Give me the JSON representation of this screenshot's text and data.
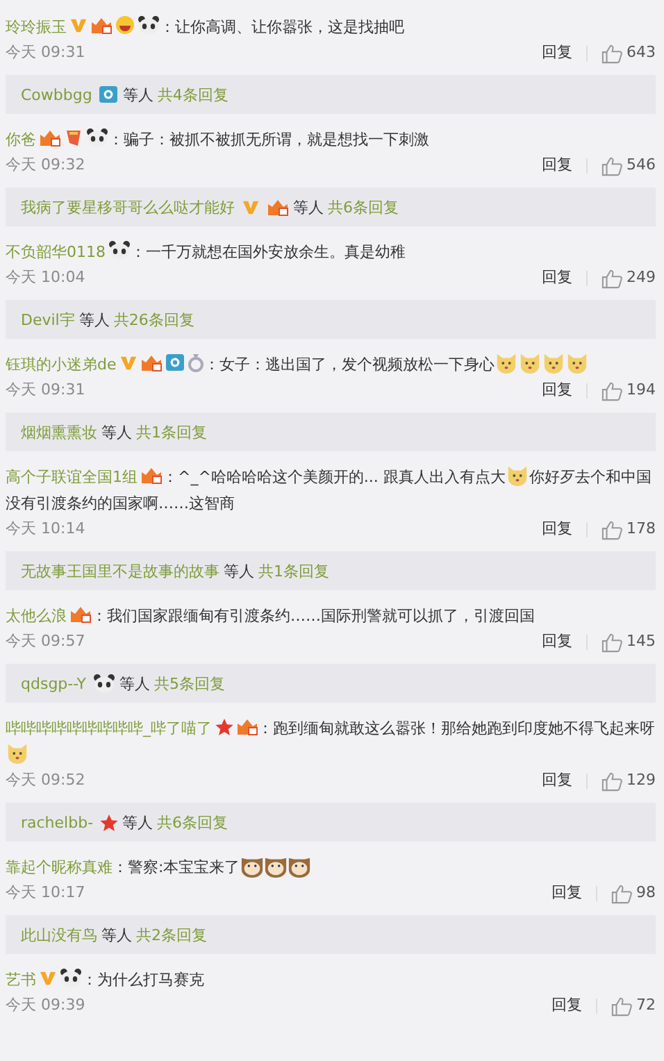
{
  "comments": [
    {
      "user": "玲玲振玉",
      "badges": [
        {
          "kind": "v"
        },
        {
          "kind": "vip"
        },
        {
          "kind": "grin"
        },
        {
          "kind": "panda"
        }
      ],
      "parts": [
        {
          "kind": "text",
          "text": "：让你高调、让你嚣张，这是找抽吧"
        }
      ],
      "time": "今天 09:31",
      "reply": "回复",
      "likes": "643",
      "thread": {
        "names": "Cowbbgg",
        "badges": [
          {
            "kind": "camera"
          }
        ],
        "others": "等人",
        "count": "共4条回复"
      }
    },
    {
      "user": "你爸",
      "badges": [
        {
          "kind": "vip"
        },
        {
          "kind": "medal"
        },
        {
          "kind": "panda"
        }
      ],
      "parts": [
        {
          "kind": "text",
          "text": "：骗子：被抓不被抓无所谓，就是想找一下刺激"
        }
      ],
      "time": "今天 09:32",
      "reply": "回复",
      "likes": "546",
      "thread": {
        "names": "我病了要星移哥哥么么哒才能好",
        "badges": [
          {
            "kind": "v"
          },
          {
            "kind": "vip"
          }
        ],
        "others": "等人",
        "count": "共6条回复"
      }
    },
    {
      "user": "不负韶华0118",
      "badges": [
        {
          "kind": "panda"
        }
      ],
      "parts": [
        {
          "kind": "text",
          "text": "：一千万就想在国外安放余生。真是幼稚"
        }
      ],
      "time": "今天 10:04",
      "reply": "回复",
      "likes": "249",
      "thread": {
        "names": "Devil宇",
        "others": "等人",
        "count": "共26条回复"
      }
    },
    {
      "user": "钰琪的小迷弟de",
      "badges": [
        {
          "kind": "v"
        },
        {
          "kind": "vip"
        },
        {
          "kind": "camera"
        },
        {
          "kind": "ring"
        }
      ],
      "parts": [
        {
          "kind": "text",
          "text": "：女子：逃出国了，发个视频放松一下身心"
        },
        {
          "kind": "cat"
        },
        {
          "kind": "cat"
        },
        {
          "kind": "cat"
        },
        {
          "kind": "cat"
        }
      ],
      "time": "今天 09:31",
      "reply": "回复",
      "likes": "194",
      "thread": {
        "names": "烟烟熏熏妆",
        "others": "等人",
        "count": "共1条回复"
      }
    },
    {
      "user": "高个子联谊全国1组",
      "badges": [
        {
          "kind": "vip"
        }
      ],
      "parts": [
        {
          "kind": "text",
          "text": "：^_^哈哈哈哈这个美颜开的... 跟真人出入有点大"
        },
        {
          "kind": "cat"
        },
        {
          "kind": "text",
          "text": "你好歹去个和中国没有引渡条约的国家啊……这智商"
        }
      ],
      "time": "今天 10:14",
      "reply": "回复",
      "likes": "178",
      "thread": {
        "names": "无故事王国里不是故事的故事",
        "others": "等人",
        "count": "共1条回复"
      }
    },
    {
      "user": "太他么浪",
      "badges": [
        {
          "kind": "vip"
        }
      ],
      "parts": [
        {
          "kind": "text",
          "text": "：我们国家跟缅甸有引渡条约……国际刑警就可以抓了，引渡回国"
        }
      ],
      "time": "今天 09:57",
      "reply": "回复",
      "likes": "145",
      "thread": {
        "names": "qdsgp--Y",
        "badges": [
          {
            "kind": "panda"
          }
        ],
        "others": "等人",
        "count": "共5条回复"
      }
    },
    {
      "user": "哔哔哔哔哔哔哔哔哔_哔了喵了",
      "badges": [
        {
          "kind": "star"
        },
        {
          "kind": "vip"
        }
      ],
      "parts": [
        {
          "kind": "text",
          "text": "：跑到缅甸就敢这么嚣张！那给她跑到印度她不得飞起来呀"
        },
        {
          "kind": "cat"
        }
      ],
      "time": "今天 09:52",
      "reply": "回复",
      "likes": "129",
      "thread": {
        "names": "rachelbb-",
        "badges": [
          {
            "kind": "star"
          }
        ],
        "others": "等人",
        "count": "共6条回复"
      }
    },
    {
      "user": "靠起个昵称真难",
      "parts": [
        {
          "kind": "text",
          "text": "：警察:本宝宝来了"
        },
        {
          "kind": "dog"
        },
        {
          "kind": "dog"
        },
        {
          "kind": "dog"
        }
      ],
      "time": "今天 10:17",
      "reply": "回复",
      "likes": "98",
      "thread": {
        "names": "此山没有鸟",
        "others": "等人",
        "count": "共2条回复"
      }
    },
    {
      "user": "艺书",
      "badges": [
        {
          "kind": "v"
        },
        {
          "kind": "panda"
        }
      ],
      "parts": [
        {
          "kind": "text",
          "text": "：为什么打马赛克"
        }
      ],
      "time": "今天 09:39",
      "reply": "回复",
      "likes": "72"
    }
  ]
}
